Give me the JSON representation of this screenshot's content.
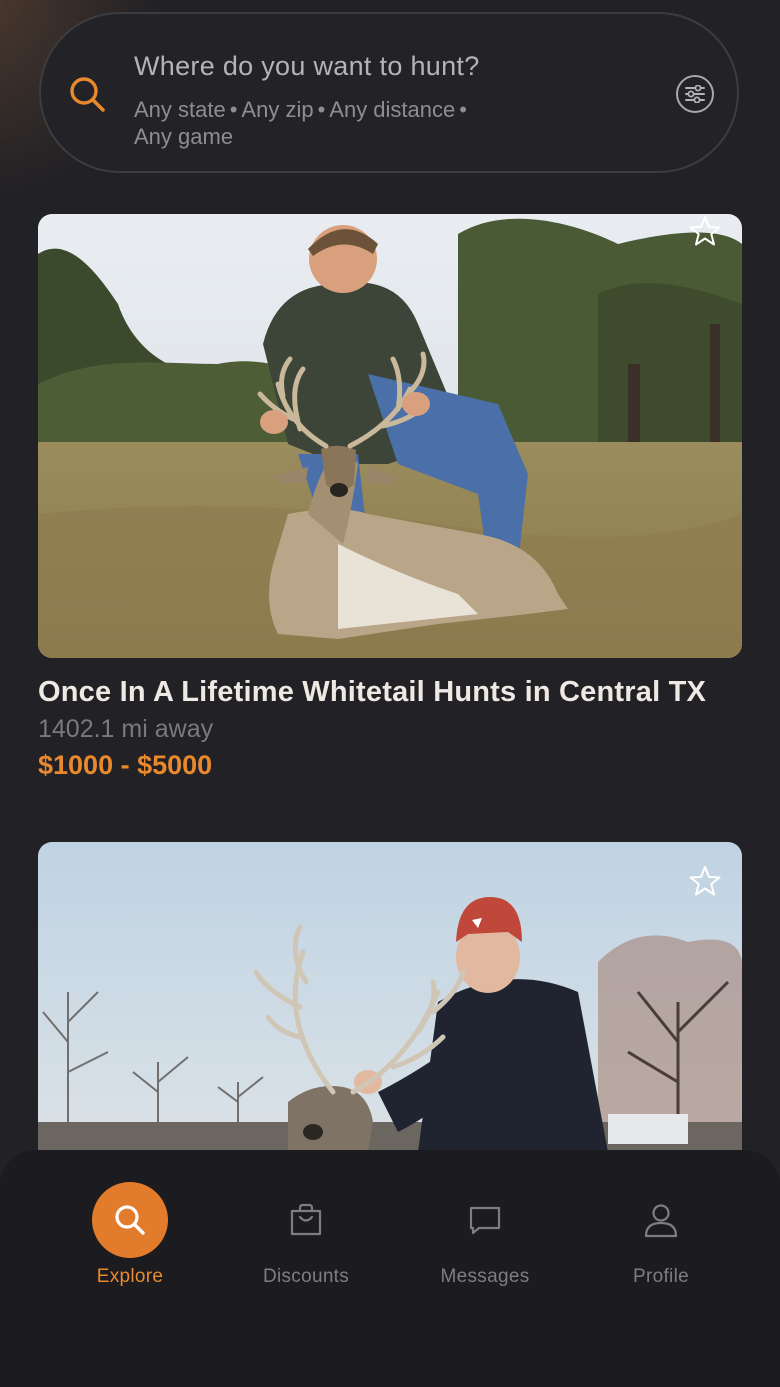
{
  "search": {
    "title": "Where do you want to hunt?",
    "state": "Any state",
    "zip": "Any zip",
    "distance": "Any distance",
    "game": "Any game",
    "separator": "•"
  },
  "listings": [
    {
      "title": "Once In A Lifetime Whitetail Hunts in Central TX",
      "distance": "1402.1 mi away",
      "price": "$1000 - $5000",
      "favorited": false
    },
    {
      "favorited": false
    }
  ],
  "nav": {
    "items": [
      {
        "label": "Explore",
        "icon": "search-icon",
        "active": true
      },
      {
        "label": "Discounts",
        "icon": "shopping-bag-icon",
        "active": false
      },
      {
        "label": "Messages",
        "icon": "message-icon",
        "active": false
      },
      {
        "label": "Profile",
        "icon": "person-icon",
        "active": false
      }
    ]
  },
  "colors": {
    "background": "#222125",
    "accent": "#e8892e",
    "title_text": "#efe9e4",
    "muted_text": "#7a797d"
  }
}
